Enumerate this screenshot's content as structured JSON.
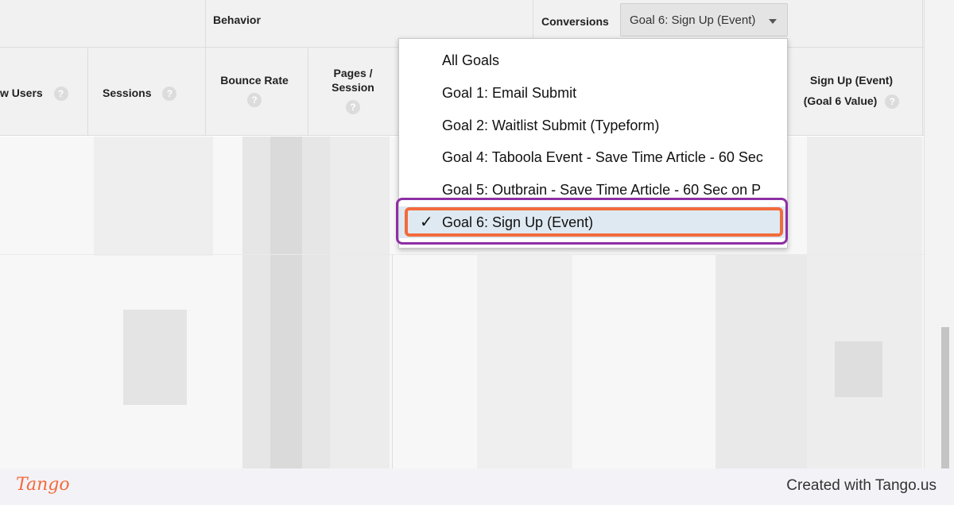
{
  "header": {
    "behavior_label": "Behavior",
    "conversions_label": "Conversions",
    "conversions_selected": "Goal 6: Sign Up (Event)"
  },
  "columns": {
    "new_users": "w Users",
    "sessions": "Sessions",
    "bounce_rate": "Bounce Rate",
    "pages_session_line1": "Pages /",
    "pages_session_line2": "Session",
    "goal_value_line1": "Sign Up (Event)",
    "goal_value_line2": "(Goal 6 Value)",
    "help_glyph": "?"
  },
  "dropdown": {
    "items": [
      {
        "label": "All Goals",
        "selected": false
      },
      {
        "label": "Goal 1: Email Submit",
        "selected": false
      },
      {
        "label": "Goal 2: Waitlist Submit (Typeform)",
        "selected": false
      },
      {
        "label": "Goal 4: Taboola Event - Save Time Article - 60 Sec",
        "selected": false
      },
      {
        "label": "Goal 5: Outbrain - Save Time Article - 60 Sec on P",
        "selected": false
      },
      {
        "label": "Goal 6: Sign Up (Event)",
        "selected": true
      }
    ],
    "check_glyph": "✓"
  },
  "footer": {
    "logo": "Tango",
    "created": "Created with Tango.us"
  },
  "colors": {
    "highlight_outer": "#8e2fa4",
    "highlight_inner": "#f26b3c",
    "selected_bg": "#dfe9f1"
  }
}
